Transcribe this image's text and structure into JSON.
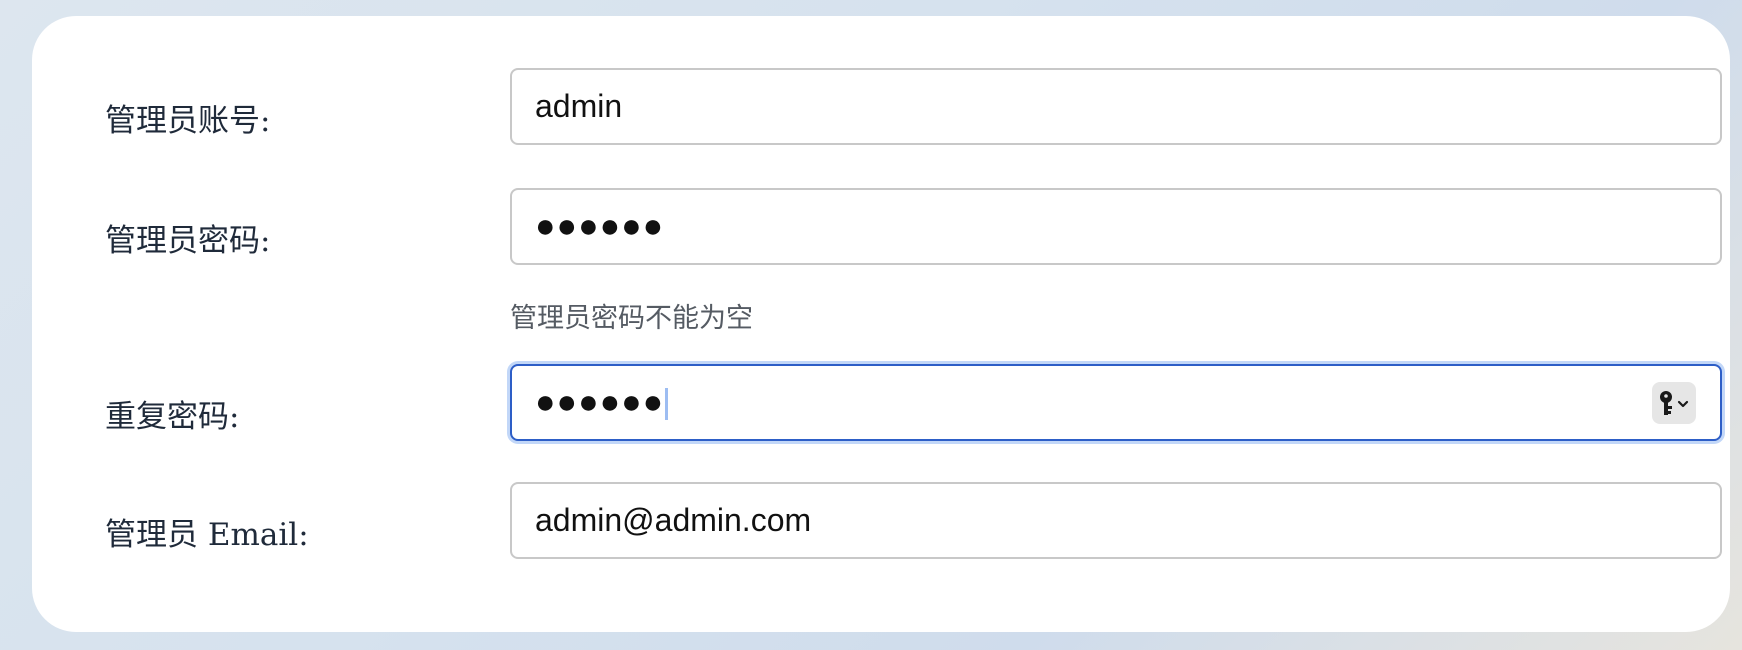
{
  "form": {
    "account_label": "管理员账号:",
    "account_value": "admin",
    "password_label": "管理员密码:",
    "password_value": "●●●●●●",
    "password_hint": "管理员密码不能为空",
    "repeat_label": "重复密码:",
    "repeat_value": "●●●●●●",
    "email_label": "管理员 Email:",
    "email_value": "admin@admin.com"
  },
  "icons": {
    "keychain": "key-icon",
    "keychain_dropdown": "chevron-down-icon"
  },
  "colors": {
    "focus_border": "#2d5ec7",
    "label_text": "#1f2a3a",
    "hint_text": "#555b63"
  }
}
